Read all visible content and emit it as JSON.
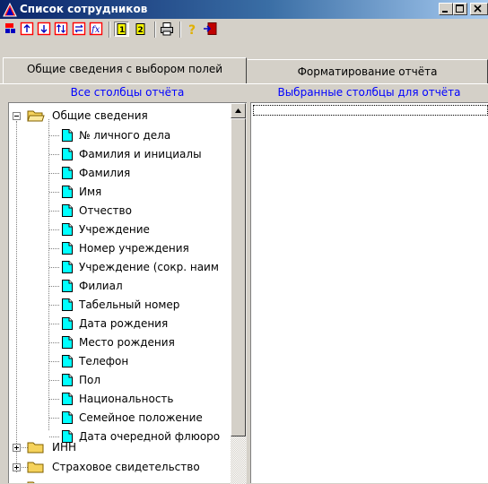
{
  "window": {
    "title": "Список сотрудников",
    "controls": [
      "minimize-icon",
      "maximize-icon",
      "close-icon"
    ]
  },
  "toolbar": {
    "buttons": [
      "fields-select-icon",
      "move-up-icon",
      "move-down-icon",
      "sort-icon",
      "swap-icon",
      "formula-icon",
      "report-page-1-icon",
      "report-page-2-icon",
      "printer-icon",
      "help-icon",
      "exit-icon"
    ]
  },
  "tabs": [
    {
      "label": "Общие сведения с выбором полей",
      "active": true
    },
    {
      "label": "Форматирование отчёта",
      "active": false
    }
  ],
  "columns": {
    "left_header": "Все столбцы отчёта",
    "right_header": "Выбранные столбцы для отчёта"
  },
  "tree": {
    "root": {
      "label": "Общие сведения",
      "expanded": true
    },
    "children": [
      "№ личного дела",
      "Фамилия и инициалы",
      "Фамилия",
      "Имя",
      "Отчество",
      "Учреждение",
      "Номер учреждения",
      "Учреждение (сокр. наим",
      "Филиал",
      "Табельный номер",
      "Дата рождения",
      "Место рождения",
      "Телефон",
      "Пол",
      "Национальность",
      "Семейное положение",
      "Дата очередной флюоро"
    ],
    "collapsed_folders": [
      "ИНН",
      "Страховое свидетельство"
    ]
  },
  "colors": {
    "title_start": "#0a246a",
    "title_end": "#a6caf0",
    "header_text": "#0000ff",
    "face": "#d4d0c8"
  }
}
